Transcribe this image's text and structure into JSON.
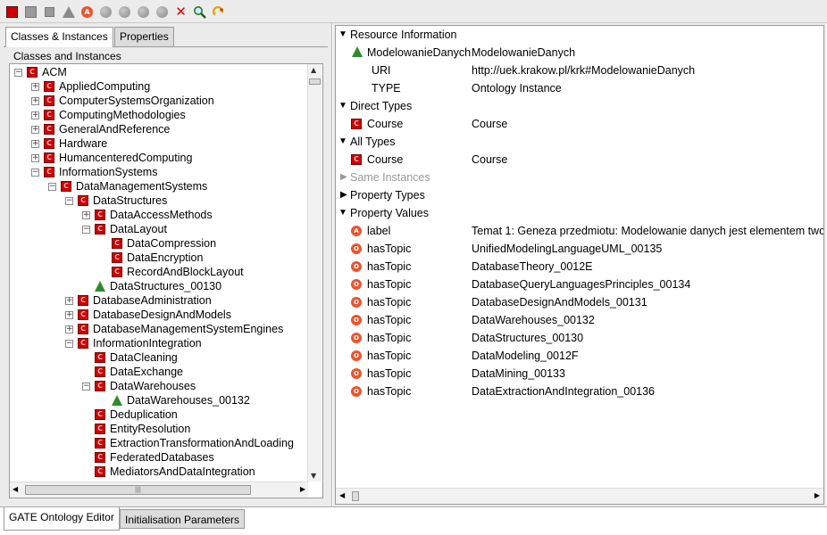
{
  "colors": {
    "class_icon": "#cc0000",
    "instance_icon": "#2e8b2e",
    "object_prop_icon": "#e8552e",
    "tab_bg": "#dcdcdc"
  },
  "toolbar": {
    "icons": [
      "new-class-icon",
      "new-subclass-icon",
      "new-top-class-icon",
      "new-instance-icon",
      "annotation-property-icon",
      "datatype-property-icon",
      "object-property-icon",
      "symmetric-property-icon",
      "transitive-property-icon",
      "delete-icon",
      "search-icon",
      "refresh-icon"
    ]
  },
  "left_tabs": {
    "classes": "Classes & Instances",
    "properties": "Properties"
  },
  "tree": {
    "title": "Classes and Instances",
    "items": [
      {
        "label": "ACM",
        "level": 0,
        "exp": "-",
        "type": "class"
      },
      {
        "label": "AppliedComputing",
        "level": 1,
        "exp": "+",
        "type": "class"
      },
      {
        "label": "ComputerSystemsOrganization",
        "level": 1,
        "exp": "+",
        "type": "class"
      },
      {
        "label": "ComputingMethodologies",
        "level": 1,
        "exp": "+",
        "type": "class"
      },
      {
        "label": "GeneralAndReference",
        "level": 1,
        "exp": "+",
        "type": "class"
      },
      {
        "label": "Hardware",
        "level": 1,
        "exp": "+",
        "type": "class"
      },
      {
        "label": "HumancenteredComputing",
        "level": 1,
        "exp": "+",
        "type": "class"
      },
      {
        "label": "InformationSystems",
        "level": 1,
        "exp": "-",
        "type": "class"
      },
      {
        "label": "DataManagementSystems",
        "level": 2,
        "exp": "-",
        "type": "class"
      },
      {
        "label": "DataStructures",
        "level": 3,
        "exp": "-",
        "type": "class"
      },
      {
        "label": "DataAccessMethods",
        "level": 4,
        "exp": "+",
        "type": "class"
      },
      {
        "label": "DataLayout",
        "level": 4,
        "exp": "-",
        "type": "class"
      },
      {
        "label": "DataCompression",
        "level": 5,
        "exp": "",
        "type": "class"
      },
      {
        "label": "DataEncryption",
        "level": 5,
        "exp": "",
        "type": "class"
      },
      {
        "label": "RecordAndBlockLayout",
        "level": 5,
        "exp": "",
        "type": "class"
      },
      {
        "label": "DataStructures_00130",
        "level": 4,
        "exp": "",
        "type": "instance"
      },
      {
        "label": "DatabaseAdministration",
        "level": 3,
        "exp": "+",
        "type": "class"
      },
      {
        "label": "DatabaseDesignAndModels",
        "level": 3,
        "exp": "+",
        "type": "class"
      },
      {
        "label": "DatabaseManagementSystemEngines",
        "level": 3,
        "exp": "+",
        "type": "class"
      },
      {
        "label": "InformationIntegration",
        "level": 3,
        "exp": "-",
        "type": "class"
      },
      {
        "label": "DataCleaning",
        "level": 4,
        "exp": "",
        "type": "class"
      },
      {
        "label": "DataExchange",
        "level": 4,
        "exp": "",
        "type": "class"
      },
      {
        "label": "DataWarehouses",
        "level": 4,
        "exp": "-",
        "type": "class"
      },
      {
        "label": "DataWarehouses_00132",
        "level": 5,
        "exp": "",
        "type": "instance"
      },
      {
        "label": "Deduplication",
        "level": 4,
        "exp": "",
        "type": "class"
      },
      {
        "label": "EntityResolution",
        "level": 4,
        "exp": "",
        "type": "class"
      },
      {
        "label": "ExtractionTransformationAndLoading",
        "level": 4,
        "exp": "",
        "type": "class"
      },
      {
        "label": "FederatedDatabases",
        "level": 4,
        "exp": "",
        "type": "class"
      },
      {
        "label": "MediatorsAndDataIntegration",
        "level": 4,
        "exp": "",
        "type": "class"
      }
    ]
  },
  "details": {
    "resource_info": "Resource Information",
    "resource_name": "ModelowanieDanych",
    "resource_label": "ModelowanieDanych",
    "uri_key": "URI",
    "uri_val": "http://uek.krakow.pl/krk#ModelowanieDanych",
    "type_key": "TYPE",
    "type_val": "Ontology Instance",
    "direct_types": "Direct Types",
    "direct_type_name": "Course",
    "direct_type_val": "Course",
    "all_types": "All Types",
    "all_type_name": "Course",
    "all_type_val": "Course",
    "same_instances": "Same Instances",
    "property_types": "Property Types",
    "property_values": "Property Values",
    "values": [
      {
        "prop": "label",
        "val": "Temat 1: Geneza przedmiotu:   Modelowanie danych jest elementem two",
        "icon": "A"
      },
      {
        "prop": "hasTopic",
        "val": "UnifiedModelingLanguageUML_00135",
        "icon": "O"
      },
      {
        "prop": "hasTopic",
        "val": "DatabaseTheory_0012E",
        "icon": "O"
      },
      {
        "prop": "hasTopic",
        "val": "DatabaseQueryLanguagesPrinciples_00134",
        "icon": "O"
      },
      {
        "prop": "hasTopic",
        "val": "DatabaseDesignAndModels_00131",
        "icon": "O"
      },
      {
        "prop": "hasTopic",
        "val": "DataWarehouses_00132",
        "icon": "O"
      },
      {
        "prop": "hasTopic",
        "val": "DataStructures_00130",
        "icon": "O"
      },
      {
        "prop": "hasTopic",
        "val": "DataModeling_0012F",
        "icon": "O"
      },
      {
        "prop": "hasTopic",
        "val": "DataMining_00133",
        "icon": "O"
      },
      {
        "prop": "hasTopic",
        "val": "DataExtractionAndIntegration_00136",
        "icon": "O"
      }
    ]
  },
  "bottom_tabs": {
    "editor": "GATE Ontology Editor",
    "params": "Initialisation Parameters"
  }
}
